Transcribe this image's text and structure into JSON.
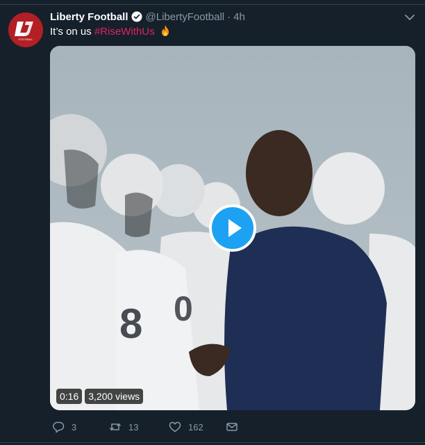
{
  "tweet": {
    "display_name": "Liberty Football",
    "handle": "@LibertyFootball",
    "separator": "·",
    "time": "4h",
    "text": "It’s on us",
    "hashtag": "#RiseWithUs",
    "emoji": "fire-emoji",
    "avatar_text": "FOOTBALL"
  },
  "video": {
    "duration": "0:16",
    "views": "3,200 views"
  },
  "actions": {
    "reply_count": "3",
    "retweet_count": "13",
    "like_count": "162"
  },
  "colors": {
    "background": "#15202b",
    "accent": "#1da1f2",
    "hashtag": "#e0245e",
    "muted": "#8899a6",
    "avatar": "#b21f24"
  }
}
